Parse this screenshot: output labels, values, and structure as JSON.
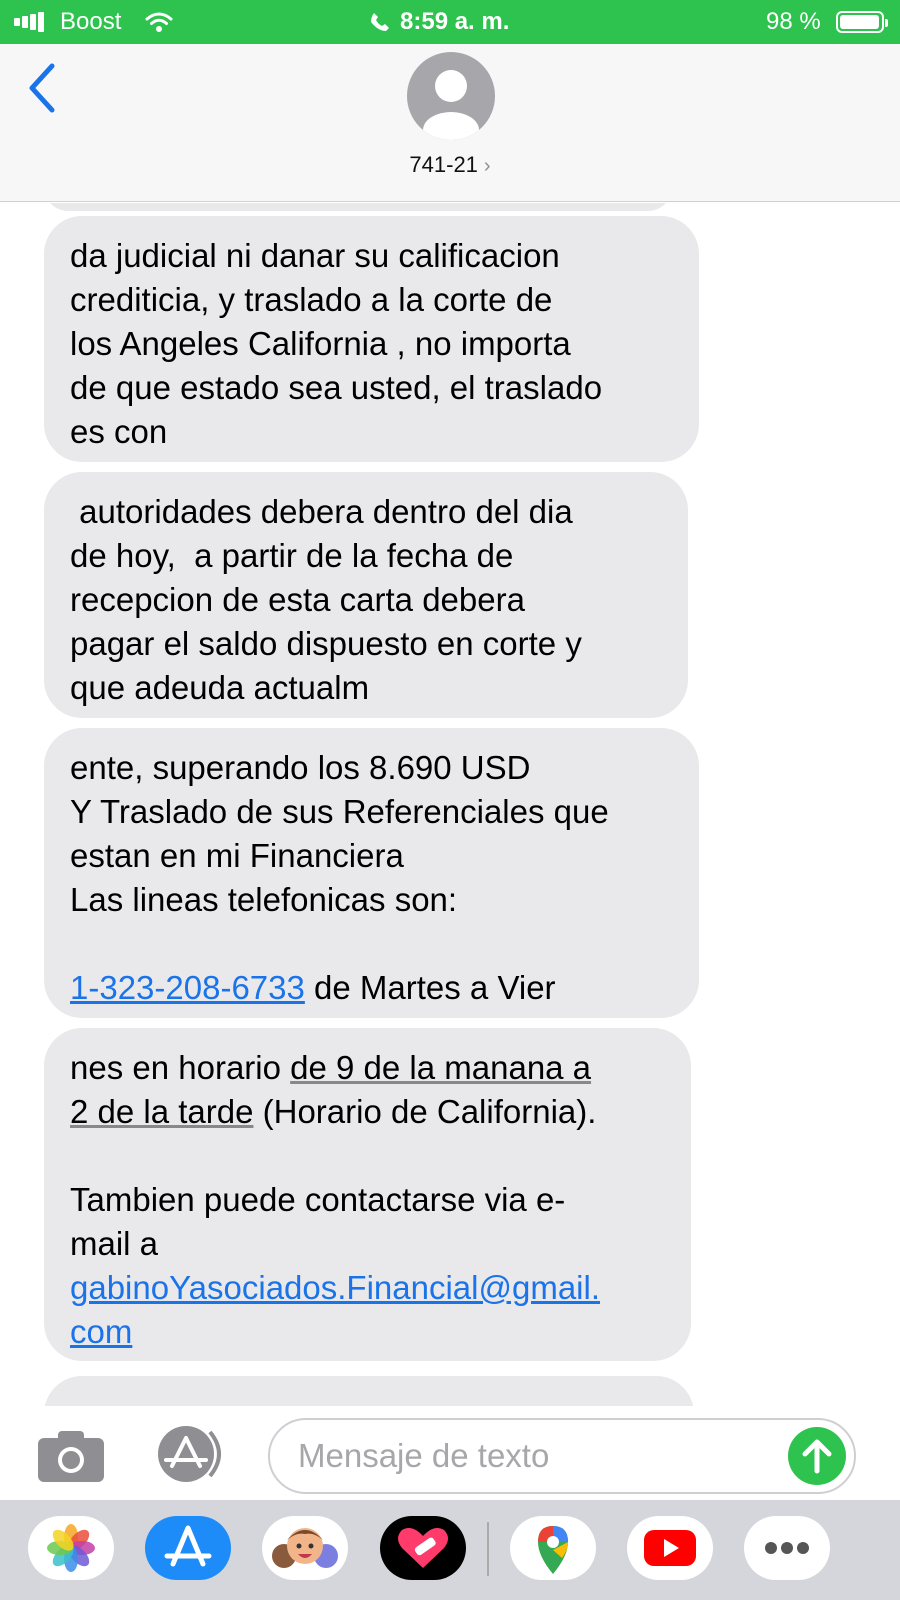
{
  "status_bar": {
    "carrier": "Boost",
    "time": "8:59 a. m.",
    "battery_percent": "98 %",
    "battery_level": 0.98,
    "background": "#2ec34f"
  },
  "header": {
    "contact_name": "741-21",
    "back_icon": "chevron-left-icon",
    "avatar_icon": "person-silhouette-icon"
  },
  "messages": [
    {
      "text": "da judicial ni danar su calificacion\ncrediticia, y traslado a la corte de\nlos Angeles California , no importa\nde que estado sea usted, el traslado\nes con"
    },
    {
      "text": " autoridades debera dentro del dia\nde hoy,  a partir de la fecha de\nrecepcion de esta carta debera\npagar el saldo dispuesto en corte y\nque adeuda actualm"
    },
    {
      "text_1": "ente, superando los 8.690 USD\nY Traslado de sus Referenciales que\nestan en mi Financiera\nLas lineas telefonicas son:\n\n",
      "phone_link": "1-323-208-6733",
      "text_2": " de Martes a Vier"
    },
    {
      "text_1": "nes en horario ",
      "underlined_1": "de 9 de la manana a",
      "underlined_2": "2 de la tarde",
      "text_2": " (Horario de California).\n\nTambien puede contactarse via e-\nmail a\n",
      "email_link": "gabinoYasociados.Financial@gmail.\ncom"
    }
  ],
  "composer": {
    "placeholder": "Mensaje de texto",
    "camera_icon": "camera-icon",
    "apps_icon": "app-store-icon",
    "send_icon": "arrow-up-icon",
    "accent": "#2ec34f"
  },
  "app_drawer": {
    "apps": [
      "photos-icon",
      "app-store-icon",
      "memoji-icon",
      "heart-app-icon",
      "google-maps-icon",
      "youtube-icon",
      "more-icon"
    ]
  },
  "link_color": "#1a73e8",
  "bubble_color": "#e9e9eb"
}
